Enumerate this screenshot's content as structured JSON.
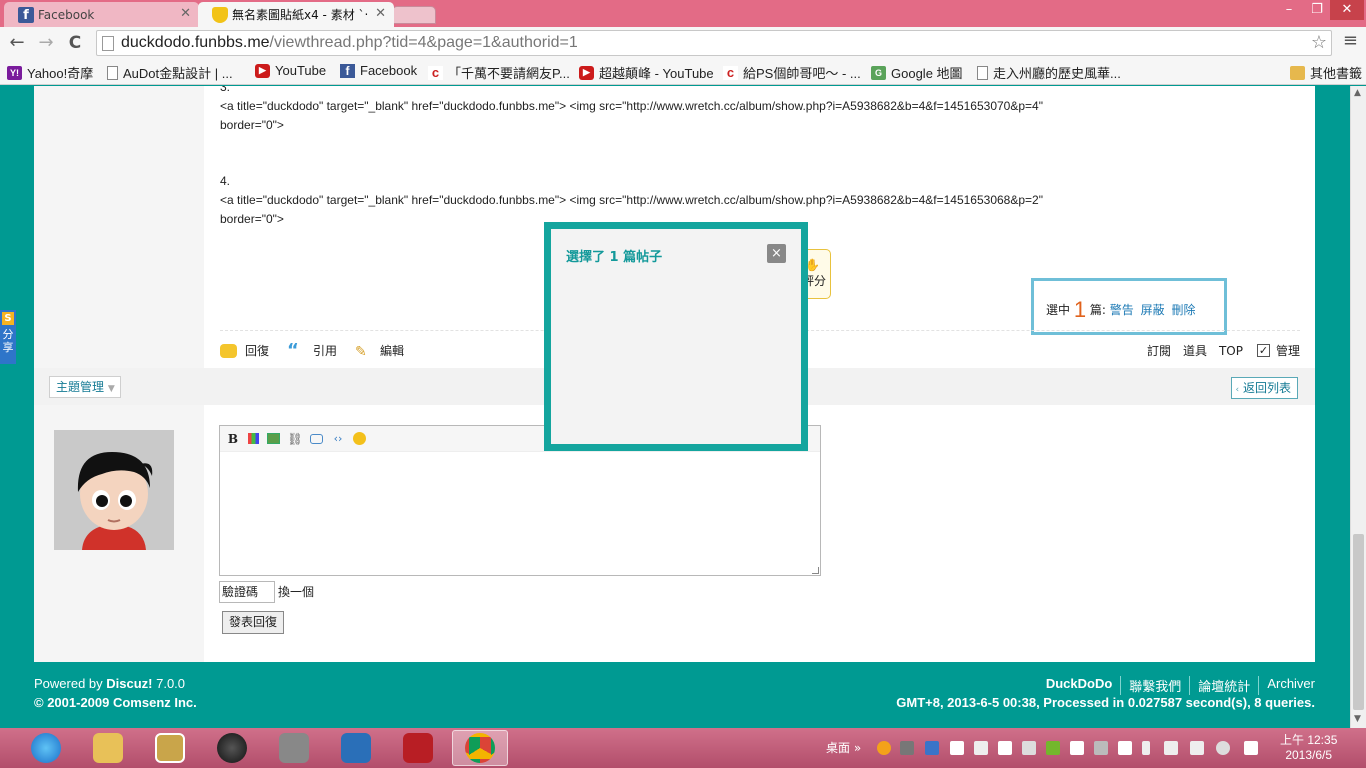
{
  "tabs": [
    {
      "title": "Facebook"
    },
    {
      "title": "無名素圖貼紙x4 - 素材 `‧"
    }
  ],
  "window_controls": {
    "minimize": "–",
    "restore": "❐",
    "close": "✕"
  },
  "toolbar": {
    "back": "←",
    "forward": "→",
    "reload": "C",
    "url_host": "duckdodo.funbbs.me",
    "url_path": "/viewthread.php?tid=4&page=1&authorid=1",
    "star": "☆",
    "menu": "≡"
  },
  "bookmarks": [
    {
      "label": "Yahoo!奇摩",
      "icon": "Y!"
    },
    {
      "label": "AuDot金點設計 | ...",
      "icon": ""
    },
    {
      "label": "YouTube",
      "icon": "▶"
    },
    {
      "label": "Facebook",
      "icon": "f"
    },
    {
      "label": "「千萬不要請網友P...",
      "icon": "c"
    },
    {
      "label": "超越顛峰 - YouTube",
      "icon": "▶"
    },
    {
      "label": "給PS個帥哥吧～ - ...",
      "icon": "c"
    },
    {
      "label": "Google 地圖",
      "icon": "G"
    },
    {
      "label": "走入州廳的歷史風華...",
      "icon": ""
    },
    {
      "label": "其他書籤",
      "icon": ""
    }
  ],
  "post": {
    "item3_num": "3.",
    "item3_line1": "<a title=\"duckdodo\" target=\"_blank\" href=\"duckdodo.funbbs.me\"> <img src=\"http://www.wretch.cc/album/show.php?i=A5938682&b=4&f=1451653070&p=4\"",
    "item3_line2": "border=\"0\">",
    "item4_num": "4.",
    "item4_line1": "<a title=\"duckdodo\" target=\"_blank\" href=\"duckdodo.funbbs.me\"> <img src=\"http://www.wretch.cc/album/show.php?i=A5938682&b=4&f=1451653068&p=2\"",
    "item4_line2": "border=\"0\">",
    "rate_label": "評分"
  },
  "selection": {
    "prefix": "選中",
    "count": "1",
    "suffix": "篇:",
    "warn": "警告",
    "block": "屏蔽",
    "delete": "刪除"
  },
  "post_actions": {
    "reply": "回復",
    "quote": "引用",
    "edit": "編輯"
  },
  "right_actions": {
    "subscribe": "訂閱",
    "tools": "道具",
    "top": "TOP",
    "manage": "管理"
  },
  "thread_bar": {
    "manage": "主題管理",
    "back": "返回列表"
  },
  "editor_tools": {
    "bold": "B"
  },
  "form": {
    "captcha": "驗證碼",
    "refresh": "換一個",
    "submit": "發表回復"
  },
  "share_tab": {
    "label": "分享"
  },
  "modal": {
    "title": "選擇了 1 篇帖子",
    "close": "×"
  },
  "footer": {
    "powered_prefix": "Powered by ",
    "powered_brand": "Discuz!",
    "powered_version": " 7.0.0",
    "copyright": "© 2001-2009 Comsenz Inc.",
    "links": [
      "DuckDoDo",
      "聯繫我們",
      "論壇統計",
      "Archiver"
    ],
    "stats": "GMT+8, 2013-6-5 00:38, Processed in 0.027587 second(s), 8 queries."
  },
  "taskbar": {
    "desktop_label": "桌面",
    "chevron": "»",
    "time": "上午 12:35",
    "date": "2013/6/5"
  },
  "colors": {
    "page_bg": "#009a92",
    "accent_link": "#1d7ab5",
    "modal_border": "#14a59e",
    "selection_count": "#e0621c"
  }
}
